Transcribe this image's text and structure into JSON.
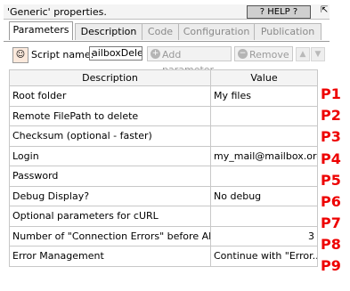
{
  "window": {
    "title": "'Generic' properties.",
    "help_label": "? HELP ?",
    "pin_glyph": "⇱"
  },
  "tabs": [
    "Parameters",
    "Description",
    "Code",
    "Configuration",
    "Publication"
  ],
  "toolbar": {
    "script_name_label": "Script name:",
    "script_name_value": "ailboxDelete",
    "add_parameter_label": "Add parameter",
    "remove_label": "Remove"
  },
  "table": {
    "headers": [
      "Description",
      "Value"
    ],
    "rows": [
      {
        "description": "Root folder",
        "value": "My files",
        "tag": "P1"
      },
      {
        "description": "Remote FilePath to delete",
        "value": "",
        "tag": "P2"
      },
      {
        "description": "Checksum (optional - faster)",
        "value": "",
        "tag": "P3"
      },
      {
        "description": "Login",
        "value": "my_mail@mailbox.org",
        "tag": "P4"
      },
      {
        "description": "Password",
        "value": "",
        "tag": "P5"
      },
      {
        "description": "Debug Display?",
        "value": "No debug",
        "tag": "P6"
      },
      {
        "description": "Optional parameters for cURL",
        "value": "",
        "tag": "P7"
      },
      {
        "description": "Number of \"Connection Errors\" before Ab...",
        "value": "3",
        "tag": "P8"
      },
      {
        "description": "Error Management",
        "value": "Continue with \"Error...",
        "tag": "P9"
      }
    ]
  },
  "colors": {
    "annotation": "#ee0000"
  }
}
